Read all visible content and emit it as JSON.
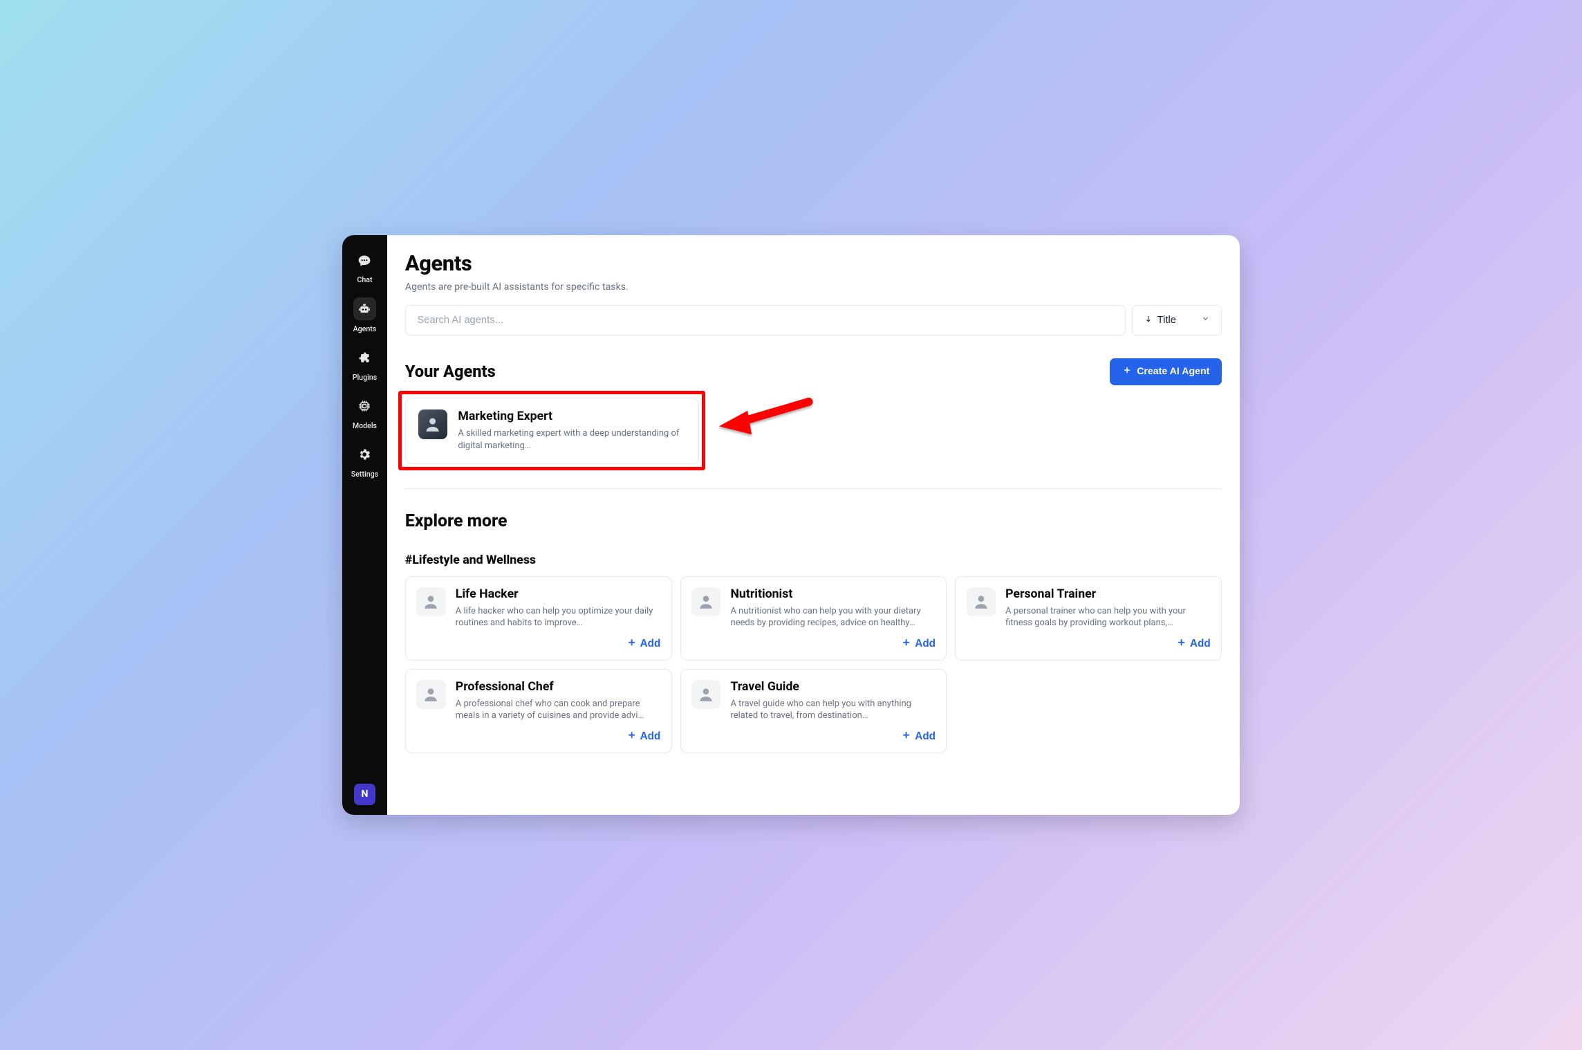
{
  "sidebar": {
    "items": [
      {
        "label": "Chat"
      },
      {
        "label": "Agents"
      },
      {
        "label": "Plugins"
      },
      {
        "label": "Models"
      },
      {
        "label": "Settings"
      }
    ],
    "avatar_initial": "N"
  },
  "header": {
    "title": "Agents",
    "subtitle": "Agents are pre-built AI assistants for specific tasks."
  },
  "search": {
    "placeholder": "Search AI agents...",
    "sort_label": "Title"
  },
  "your_agents": {
    "title": "Your Agents",
    "create_btn": "Create AI Agent",
    "cards": [
      {
        "title": "Marketing Expert",
        "desc": "A skilled marketing expert with a deep understanding of digital marketing…"
      }
    ]
  },
  "explore": {
    "title": "Explore more",
    "category": "#Lifestyle and Wellness",
    "add_label": "Add",
    "cards": [
      {
        "title": "Life Hacker",
        "desc": "A life hacker who can help you optimize your daily routines and habits to improve…"
      },
      {
        "title": "Nutritionist",
        "desc": "A nutritionist who can help you with your dietary needs by providing recipes, advice on healthy…"
      },
      {
        "title": "Personal Trainer",
        "desc": "A personal trainer who can help you with your fitness goals by providing workout plans,…"
      },
      {
        "title": "Professional Chef",
        "desc": "A professional chef who can cook and prepare meals in a variety of cuisines and provide advi…"
      },
      {
        "title": "Travel Guide",
        "desc": "A travel guide who can help you with anything related to travel, from destination…"
      }
    ]
  }
}
